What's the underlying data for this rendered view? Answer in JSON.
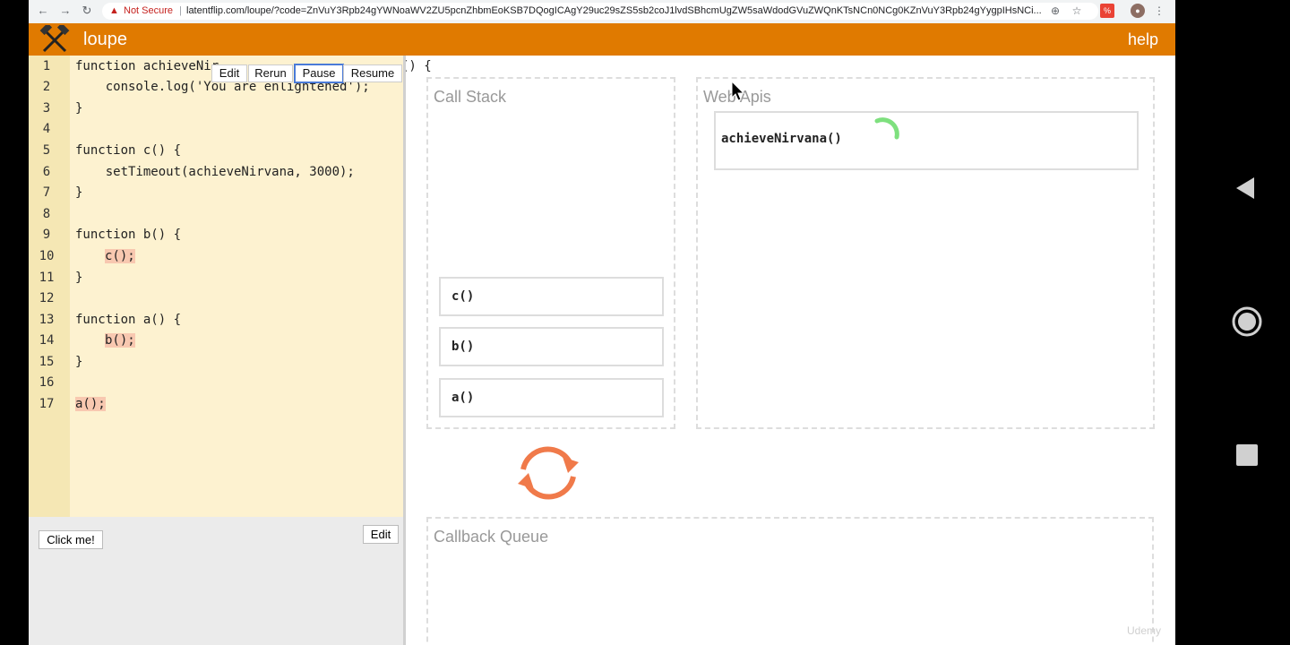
{
  "browser": {
    "not_secure_label": "Not Secure",
    "url": "latentflip.com/loupe/?code=ZnVuY3Rpb24gYWNoaWV2ZU5pcnZhbmEoKSB7DQogICAgY29uc29sZS5sb2coJ1lvdSBhcmUgZW5saWdodGVuZWQnKTsNCn0NCg0KZnVuY3Rpb24gYygpIHsNCi..."
  },
  "app": {
    "title": "loupe",
    "help_label": "help",
    "header_color": "#e07a00"
  },
  "editor": {
    "toolbar": {
      "edit_label": "Edit",
      "rerun_label": "Rerun",
      "pause_label": "Pause",
      "resume_label": "Resume"
    },
    "line_numbers": [
      "1",
      "2",
      "3",
      "4",
      "5",
      "6",
      "7",
      "8",
      "9",
      "10",
      "11",
      "12",
      "13",
      "14",
      "15",
      "16",
      "17"
    ],
    "lines": [
      "function achieveNir",
      "() {",
      "    console.log('You are enlightened');",
      "}",
      "function c() {",
      "    setTimeout(achieveNirvana, 3000);",
      "}",
      "function b() {",
      "c();",
      "}",
      "function a() {",
      "b();",
      "}",
      "a();"
    ]
  },
  "dom_panel": {
    "click_button_label": "Click me!",
    "edit_label": "Edit"
  },
  "call_stack": {
    "title": "Call Stack",
    "frames": [
      "c()",
      "b()",
      "a()"
    ]
  },
  "web_apis": {
    "title": "Web Apis",
    "items": [
      "achieveNirvana()"
    ]
  },
  "callback_queue": {
    "title": "Callback Queue"
  },
  "watermark": "Udemy",
  "colors": {
    "editor_bg": "#fdf2d0",
    "highlight": "#f8c8b0",
    "event_loop": "#f07a4a",
    "spinner": "#7ee07e",
    "active_button_border": "#4a7bd8"
  }
}
